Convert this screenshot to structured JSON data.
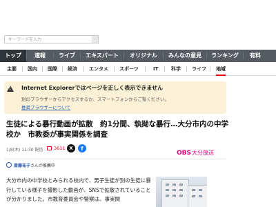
{
  "search": {
    "placeholder": "キーワードを入力"
  },
  "nav": {
    "items": [
      {
        "label": "トップ",
        "active": true
      },
      {
        "label": "速報",
        "active": false
      },
      {
        "label": "ライブ",
        "active": false
      },
      {
        "label": "エキスパート",
        "active": false
      },
      {
        "label": "オリジナル",
        "active": false
      },
      {
        "label": "みんなの意見",
        "active": false
      },
      {
        "label": "ランキング",
        "active": false
      },
      {
        "label": "有料",
        "active": false
      }
    ]
  },
  "subnav": {
    "items": [
      {
        "label": "主要",
        "active": false
      },
      {
        "label": "国内",
        "active": false
      },
      {
        "label": "国際",
        "active": false
      },
      {
        "label": "経済",
        "active": false
      },
      {
        "label": "エンタメ",
        "active": false
      },
      {
        "label": "スポーツ",
        "active": false
      },
      {
        "label": "IT",
        "active": false
      },
      {
        "label": "科学",
        "active": false
      },
      {
        "label": "ライフ",
        "active": false
      },
      {
        "label": "地域",
        "active": true
      }
    ]
  },
  "ie_notice": {
    "title": "Internet Explorerではページを正しく表示できません",
    "message": "別のブラウザーからアクセスするか、スマートフォンからご覧ください。",
    "link": "推奨ブラウザーについて"
  },
  "article": {
    "headline": "生徒による暴行動画が拡散　約1分間、執拗な暴行…大分市内の中学校か　市教委が事実関係を調査",
    "date": "1/8(木) 11:30 配信",
    "comment_count": "3611",
    "source": {
      "mark": "OBS",
      "name": "大分放送"
    },
    "reporter": {
      "name": "斎藤祐子",
      "suffix": "さんが推薦中"
    },
    "body": "大分市内の中学校とみられる校内で、男子生徒が別の生徒に暴行している様子を撮影した動画が、SNSで拡散されていることが分かりました。市教育委員会や警察は、事実関"
  },
  "colors": {
    "nav_bg": "#555b60",
    "nav_active": "#2f3438",
    "banner_bg": "#fbf1d6",
    "link": "#2a62b8",
    "accent_red": "#e60012",
    "obs_pink": "#e4007f",
    "facebook": "#1877f2"
  },
  "icons": {
    "warning": "warning-icon",
    "comment": "comment-icon",
    "x": "x-share-icon",
    "facebook": "facebook-share-icon",
    "reporter": "expert-badge-icon"
  }
}
